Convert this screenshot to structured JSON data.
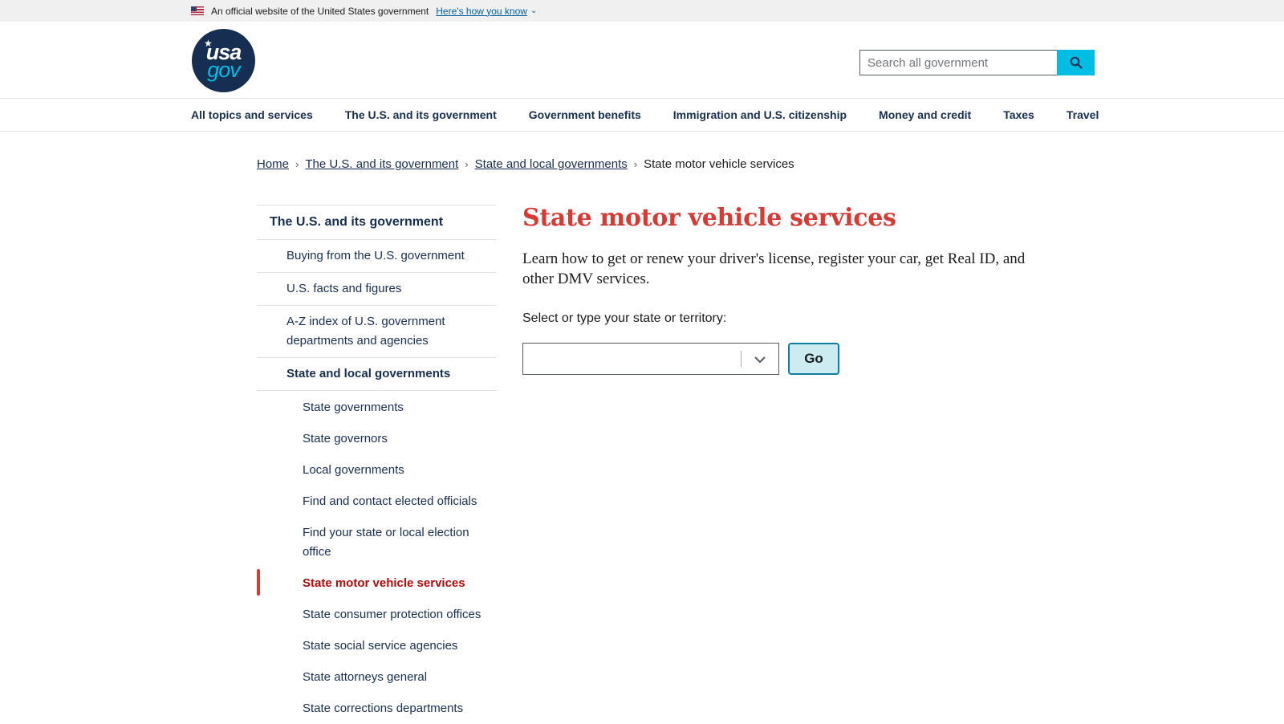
{
  "banner": {
    "official_text": "An official website of the United States government",
    "how_link": "Here's how you know"
  },
  "header": {
    "logo_line1": "usa",
    "logo_line2": "gov",
    "search_placeholder": "Search all government"
  },
  "nav": {
    "items": [
      "All topics and services",
      "The U.S. and its government",
      "Government benefits",
      "Immigration and U.S. citizenship",
      "Money and credit",
      "Taxes",
      "Travel"
    ]
  },
  "breadcrumb": {
    "items": [
      "Home",
      "The U.S. and its government",
      "State and local governments"
    ],
    "current": "State motor vehicle services"
  },
  "sidenav": {
    "top": "The U.S. and its government",
    "level2": [
      "Buying from the U.S. government",
      "U.S. facts and figures",
      "A-Z index of U.S. government departments and agencies",
      "State and local governments"
    ],
    "level3": [
      "State governments",
      "State governors",
      "Local governments",
      "Find and contact elected officials",
      "Find your state or local election office",
      "State motor vehicle services",
      "State consumer protection offices",
      "State social service agencies",
      "State attorneys general",
      "State corrections departments"
    ]
  },
  "main": {
    "title": "State motor vehicle services",
    "lead": "Learn how to get or renew your driver's license, register your car, get Real ID, and other DMV services.",
    "select_label": "Select or type your state or territory:",
    "select_value": "",
    "go_label": "Go"
  },
  "colors": {
    "navy": "#162e51",
    "title_red": "#d83933",
    "current_red": "#b50909",
    "cyan": "#00bde3",
    "link_blue": "#005ea2"
  },
  "icons": {
    "flag": "us-flag-icon",
    "how_chevron": "chevron-down-icon",
    "search": "search-icon",
    "crumb_sep": "chevron-right-icon",
    "select_arrow": "chevron-down-icon"
  }
}
